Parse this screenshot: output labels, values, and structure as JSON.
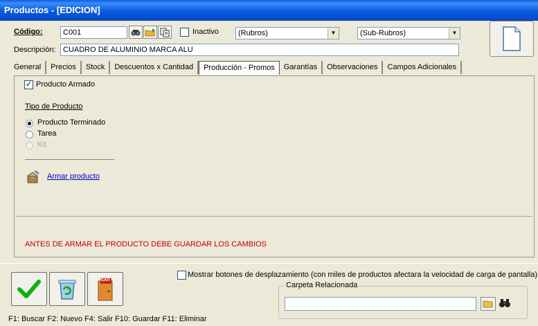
{
  "window": {
    "title": "Productos - [EDICION]"
  },
  "header": {
    "codigo_label": "Código:",
    "codigo_value": "C001",
    "inactivo_label": "Inactivo",
    "rubros_value": "(Rubros)",
    "subrubros_value": "(Sub-Rubros)",
    "descripcion_label": "Descripción:",
    "descripcion_value": "CUADRO DE ALUMINIO MARCA ALU"
  },
  "tabs": [
    {
      "label": "General"
    },
    {
      "label": "Precios"
    },
    {
      "label": "Stock"
    },
    {
      "label": "Descuentos x Cantidad"
    },
    {
      "label": "Producción - Promos",
      "active": true
    },
    {
      "label": "Garantías"
    },
    {
      "label": "Observaciones"
    },
    {
      "label": "Campos Adicionales"
    }
  ],
  "panel": {
    "producto_armado_label": "Producto Armado",
    "producto_armado_checked": true,
    "tipo_label": "Tipo de Producto",
    "options": [
      {
        "label": "Producto Terminado",
        "selected": true,
        "enabled": true
      },
      {
        "label": "Tarea",
        "selected": false,
        "enabled": true
      },
      {
        "label": "Kit",
        "selected": false,
        "enabled": false
      }
    ],
    "armar_link": "Armar producto",
    "warning": "ANTES DE ARMAR EL PRODUCTO DEBE GUARDAR LOS CAMBIOS",
    "warning_color": "#c00000"
  },
  "footer": {
    "mostrar_label": "Mostrar botones de desplazamiento  (con miles de productos afectara la velocidad de carga de pantalla)",
    "carpeta_label": "Carpeta Relacionada",
    "carpeta_value": "",
    "shortcuts": "F1: Buscar  F2: Nuevo  F4: Salir  F10: Guardar  F11: Eliminar",
    "exit_label": "EXIT"
  }
}
